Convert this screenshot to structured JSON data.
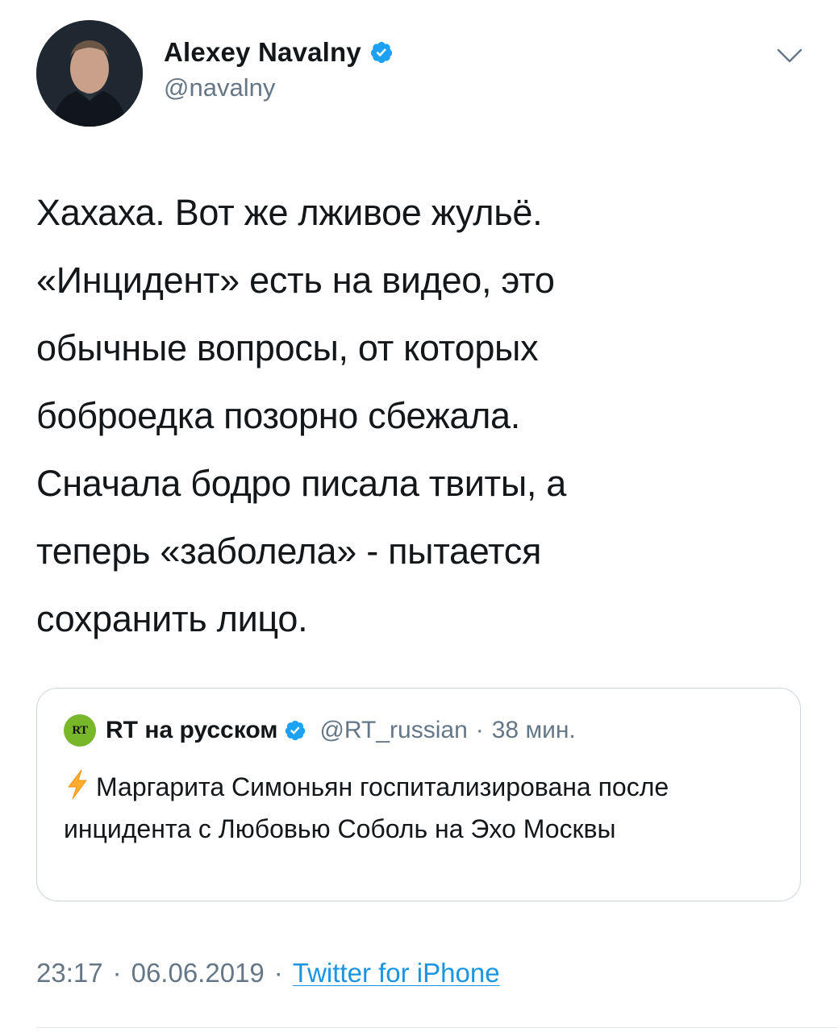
{
  "tweet": {
    "author": {
      "display_name": "Alexey Navalny",
      "handle": "@navalny",
      "verified": true,
      "avatar": "author-avatar-photo"
    },
    "menu_icon": "chevron-down-icon",
    "text": "Хахаха. Вот же лживое жульё.\n«Инцидент» есть на видео, это\nобычные вопросы, от которых\nбоброедка позорно сбежала.\nСначала бодро писала твиты, а\nтеперь «заболела» -  пытается\nсохранить лицо.",
    "quoted_tweet": {
      "logo_text": "RT",
      "display_name": "RT на русском",
      "verified": true,
      "handle": "@RT_russian",
      "separator": "·",
      "time": "38 мин.",
      "emoji": "lightning-icon",
      "text": "Маргарита Симоньян госпитализирована после инцидента с Любовью Соболь на Эхо Москвы"
    },
    "meta": {
      "time": "23:17",
      "separator": "·",
      "date": "06.06.2019",
      "source": "Twitter for iPhone"
    }
  },
  "colors": {
    "verified_badge": "#1da1f2",
    "link": "#1b95e0",
    "secondary_text": "#657786",
    "border": "#ccd6dd",
    "rt_logo": "#78b72a",
    "bolt": "#ffac33"
  }
}
